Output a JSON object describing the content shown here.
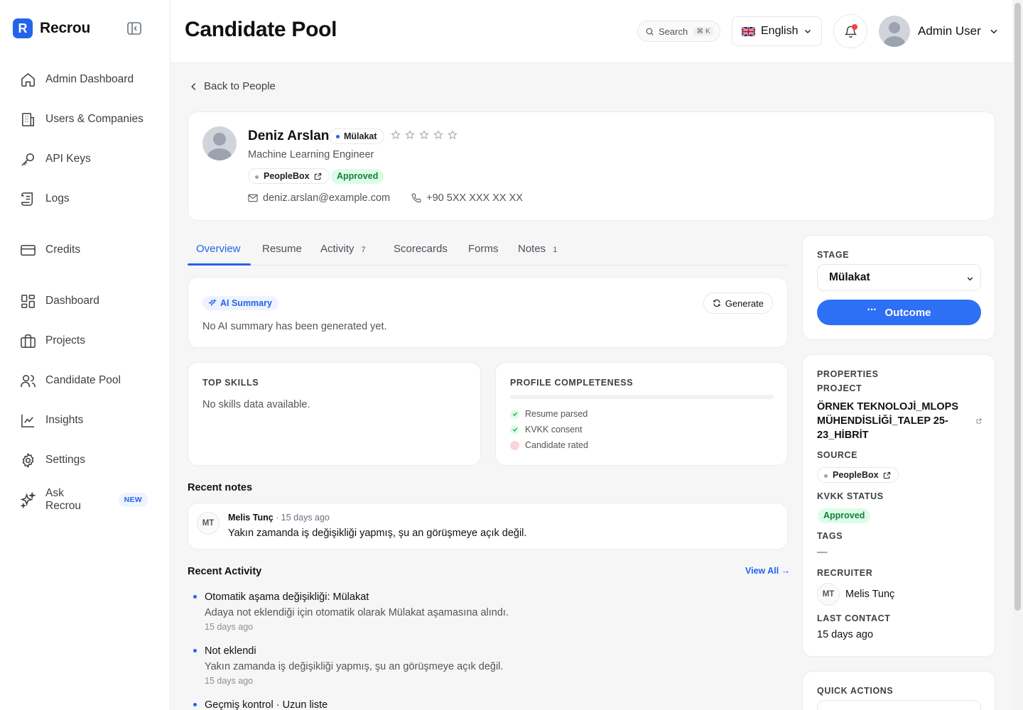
{
  "brand": {
    "name": "Recrou",
    "logo_letter": "R",
    "accent": "#2563eb"
  },
  "sidebar": {
    "items": [
      {
        "label": "Admin Dashboard",
        "icon": "home-icon"
      },
      {
        "label": "Users & Companies",
        "icon": "building-icon"
      },
      {
        "label": "API Keys",
        "icon": "key-icon"
      },
      {
        "label": "Logs",
        "icon": "scroll-icon"
      },
      {
        "label": "Credits",
        "icon": "credit-card-icon"
      },
      {
        "label": "Dashboard",
        "icon": "dashboard-icon"
      },
      {
        "label": "Projects",
        "icon": "briefcase-icon"
      },
      {
        "label": "Candidate Pool",
        "icon": "users-icon"
      },
      {
        "label": "Insights",
        "icon": "chart-line-icon"
      },
      {
        "label": "Settings",
        "icon": "gear-icon"
      },
      {
        "label": "Ask Recrou",
        "icon": "sparkles-icon",
        "badge": "NEW"
      }
    ]
  },
  "header": {
    "title": "Candidate Pool",
    "search_label": "Search",
    "search_shortcut": "⌘ K",
    "language": "English",
    "user_name": "Admin User"
  },
  "back_link": "Back to People",
  "candidate": {
    "name": "Deniz Arslan",
    "stage": "Mülakat",
    "rating": 0,
    "rating_max": 5,
    "role": "Machine Learning Engineer",
    "source": "PeopleBox",
    "kvkk": "Approved",
    "email": "deniz.arslan@example.com",
    "phone": "+90 5XX XXX XX XX"
  },
  "tabs": [
    {
      "label": "Overview",
      "count": ""
    },
    {
      "label": "Resume",
      "count": ""
    },
    {
      "label": "Activity",
      "count": "7"
    },
    {
      "label": "Scorecards",
      "count": ""
    },
    {
      "label": "Forms",
      "count": ""
    },
    {
      "label": "Notes",
      "count": "1"
    }
  ],
  "ai_summary": {
    "label": "AI Summary",
    "empty_text": "No AI summary has been generated yet.",
    "generate_label": "Generate"
  },
  "top_skills": {
    "title": "TOP SKILLS",
    "empty_text": "No skills data available."
  },
  "completeness": {
    "title": "PROFILE COMPLETENESS",
    "progress": 0,
    "items": [
      {
        "label": "Resume parsed",
        "done": true
      },
      {
        "label": "KVKK consent",
        "done": true
      },
      {
        "label": "Candidate rated",
        "done": false
      }
    ]
  },
  "recent_notes": {
    "title": "Recent notes",
    "items": [
      {
        "initials": "MT",
        "author": "Melis Tunç",
        "time": "· 15 days ago",
        "text": "Yakın zamanda iş değişikliği yapmış, şu an görüşmeye açık değil."
      }
    ]
  },
  "recent_activity": {
    "title": "Recent Activity",
    "view_all": "View All →",
    "items": [
      {
        "title": "Otomatik aşama değişikliği: Mülakat",
        "desc": "Adaya not eklendiği için otomatik olarak Mülakat aşamasına alındı.",
        "time": "15 days ago"
      },
      {
        "title": "Not eklendi",
        "desc": "Yakın zamanda iş değişikliği yapmış, şu an görüşmeye açık değil.",
        "time": "15 days ago"
      },
      {
        "title": "Geçmiş kontrol · Uzun liste",
        "desc": "",
        "time": ""
      }
    ]
  },
  "stage_panel": {
    "label": "STAGE",
    "value": "Mülakat",
    "outcome_label": "Outcome"
  },
  "properties": {
    "title": "PROPERTIES",
    "project_label": "PROJECT",
    "project_value": "ÖRNEK TEKNOLOJİ_MLOPS MÜHENDİSLİĞİ_TALEP 25-23_HİBRİT",
    "source_label": "SOURCE",
    "source_value": "PeopleBox",
    "kvkk_label": "KVKK STATUS",
    "kvkk_value": "Approved",
    "tags_label": "TAGS",
    "tags_value": "—",
    "recruiter_label": "RECRUITER",
    "recruiter_initials": "MT",
    "recruiter_name": "Melis Tunç",
    "last_contact_label": "LAST CONTACT",
    "last_contact_value": "15 days ago"
  },
  "quick_actions": {
    "title": "QUICK ACTIONS"
  }
}
